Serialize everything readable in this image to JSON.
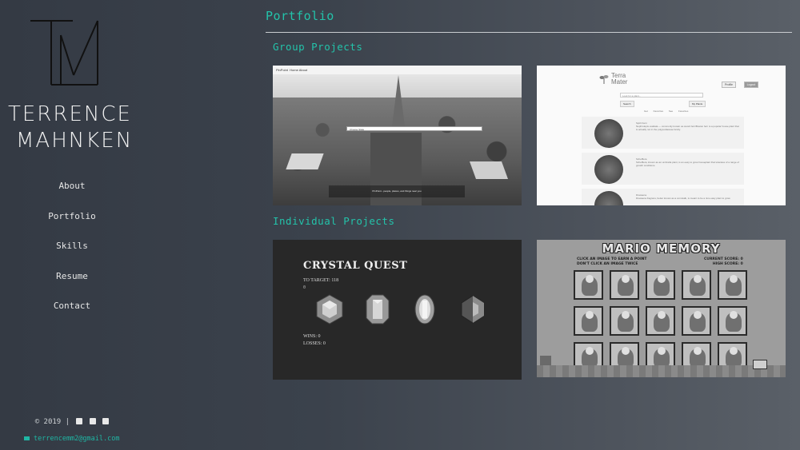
{
  "sidebar": {
    "name_line1": "TERRENCE",
    "name_line2": "MAHNKEN",
    "nav": [
      "About",
      "Portfolio",
      "Skills",
      "Resume",
      "Contact"
    ],
    "copyright": "© 2019  |",
    "social_icons": [
      "github-icon",
      "linkedin-icon",
      "twitter-icon"
    ],
    "email": "terrencemm2@gmail.com"
  },
  "main": {
    "title": "Portfolio",
    "group_title": "Group Projects",
    "individual_title": "Individual Projects"
  },
  "projects": {
    "p1": {
      "app_name": "PinPoint",
      "nav": "Home  About",
      "search_placeholder": "Choose State",
      "caption": "PinPoint - people, places, and things near you"
    },
    "p2": {
      "logo_line1": "Terra",
      "logo_line2": "Mater",
      "btn1": "Profile",
      "btn2": "Logout",
      "search_placeholder": "Look for a plant...",
      "search_btn": "Search",
      "myplants_btn": "My Plants",
      "links": "Get Favorites  See Favorites",
      "row1_title": "Spirit Fern",
      "row1_text": "Nephrolepis exaltata — commonly known as sword fern/Boston fern is a popular house plant that is actually not in the polypodiaceae family.",
      "row2_title": "Schefflera",
      "row2_text": "Schefflera, known as an umbrella plant, is an easy to grow houseplant that tolerates of a range of growth conditions.",
      "row3_title": "Dracaena",
      "row3_text": "Dracaena fragrans, better known as a cornstalk, is meant to be a nice easy plant to grow."
    },
    "p3": {
      "title": "CRYSTAL QUEST",
      "target": "TO TARGET: 118",
      "dot": "0",
      "wins": "WINS: 0",
      "losses": "LOSSES: 0"
    },
    "p4": {
      "title": "MARIO MEMORY",
      "inst1": "CLICK AN IMAGE TO EARN A POINT",
      "inst2": "DON'T CLICK AN IMAGE TWICE",
      "score1": "CURRENT SCORE: 0",
      "score2": "HIGH SCORE: 0"
    }
  },
  "colors": {
    "accent": "#23c3aa",
    "text": "#e6e6e6"
  }
}
